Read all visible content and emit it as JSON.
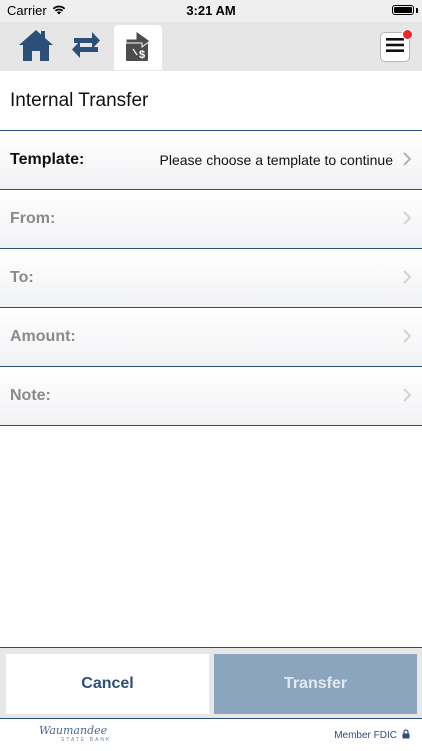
{
  "status_bar": {
    "carrier": "Carrier",
    "time": "3:21 AM"
  },
  "nav": {
    "icons": [
      "home-icon",
      "transfer-arrows-icon",
      "internal-transfer-icon",
      "hamburger-menu-icon"
    ],
    "accent_color": "#2c4f7a",
    "notification_color": "#e8282b"
  },
  "page": {
    "title": "Internal Transfer"
  },
  "form": {
    "template": {
      "label": "Template:",
      "value": "Please choose a template to continue"
    },
    "from": {
      "label": "From:"
    },
    "to": {
      "label": "To:"
    },
    "amount": {
      "label": "Amount:"
    },
    "note": {
      "label": "Note:"
    }
  },
  "actions": {
    "cancel_label": "Cancel",
    "transfer_label": "Transfer",
    "transfer_color": "#8aa5bd"
  },
  "footer": {
    "logo_text": "Waumandee",
    "logo_subtext": "STATE BANK",
    "fdic_text": "Member FDIC"
  }
}
